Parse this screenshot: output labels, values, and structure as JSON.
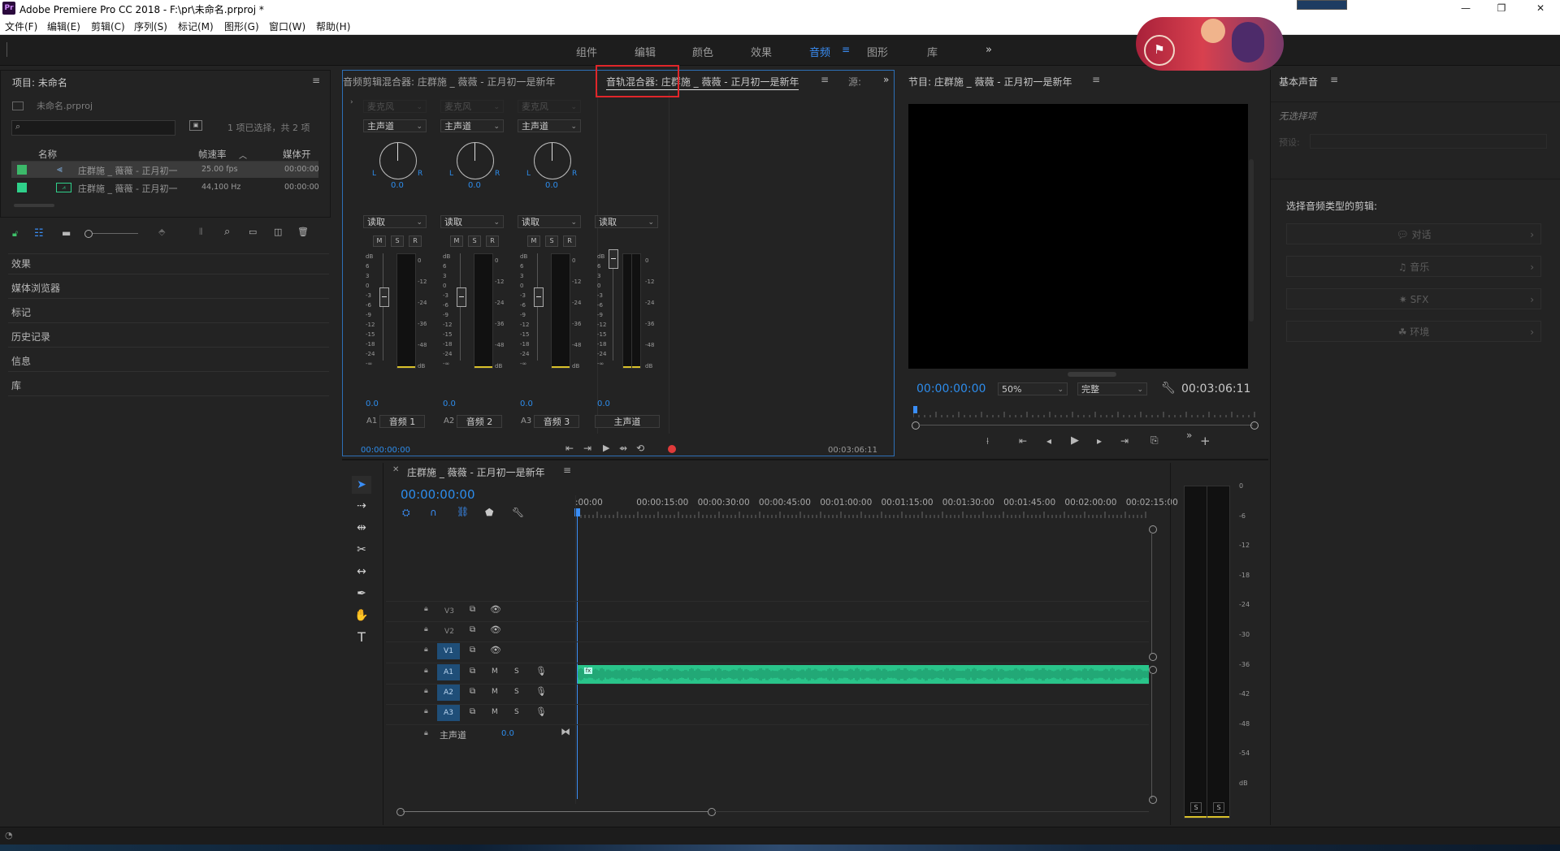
{
  "window": {
    "title": "Adobe Premiere Pro CC 2018 - F:\\pr\\未命名.prproj *",
    "app_badge": "Pr",
    "controls": [
      "—",
      "❐",
      "✕"
    ]
  },
  "menu": [
    "文件(F)",
    "编辑(E)",
    "剪辑(C)",
    "序列(S)",
    "标记(M)",
    "图形(G)",
    "窗口(W)",
    "帮助(H)"
  ],
  "workspaces": {
    "tabs": [
      "组件",
      "编辑",
      "颜色",
      "效果",
      "音频",
      "图形",
      "库"
    ],
    "active": "音频",
    "overflow": "»"
  },
  "project": {
    "title": "项目: 未命名",
    "file": "未命名.prproj",
    "selection_info": "1 项已选择，共 2 项",
    "columns": [
      "名称",
      "帧速率",
      "媒体开始"
    ],
    "items": [
      {
        "name": "庄群施 _ 薇薇 - 正月初一",
        "rate": "25.00 fps",
        "start": "00:00:00",
        "color": "#3cb96a"
      },
      {
        "name": "庄群施 _ 薇薇 - 正月初一",
        "rate": "44,100 Hz",
        "start": "00:00:00",
        "color": "#2fd08a"
      }
    ]
  },
  "left_panels": [
    "效果",
    "媒体浏览器",
    "标记",
    "历史记录",
    "信息",
    "库"
  ],
  "mixer": {
    "tab_clip": "音频剪辑混合器: 庄群施 _ 薇薇 - 正月初一是新年",
    "tab_track": "音轨混合器: 庄群施 _ 薇薇 - 正月初一是新年",
    "tab_source": "源:",
    "input_label": "麦克风",
    "output": "主声道",
    "automation": "读取",
    "pan_value": "0.0",
    "fader_value": "0.0",
    "msr": [
      "M",
      "S",
      "R"
    ],
    "channels": [
      {
        "id": "A1",
        "name": "音频 1"
      },
      {
        "id": "A2",
        "name": "音频 2"
      },
      {
        "id": "A3",
        "name": "音频 3"
      }
    ],
    "master_name": "主声道",
    "db_scale": [
      "dB",
      "6",
      "3",
      "0",
      "-3",
      "-6",
      "-9",
      "-12",
      "-15",
      "-18",
      "-24",
      "-∞"
    ],
    "meter_scale": [
      "0",
      "-12",
      "-24",
      "-36",
      "-48",
      "dB"
    ],
    "timecode_in": "00:00:00:00",
    "timecode_out": "00:03:06:11"
  },
  "program": {
    "title": "节目: 庄群施 _ 薇薇 - 正月初一是新年",
    "timecode": "00:00:00:00",
    "zoom": "50%",
    "quality": "完整",
    "duration": "00:03:06:11"
  },
  "essential_sound": {
    "title": "基本声音",
    "no_selection": "无选择项",
    "preset_label": "预设:",
    "prompt": "选择音频类型的剪辑:",
    "types": [
      "对话",
      "音乐",
      "SFX",
      "环境"
    ]
  },
  "timeline": {
    "title": "庄群施 _ 薇薇 - 正月初一是新年",
    "timecode": "00:00:00:00",
    "ruler": [
      ":00:00",
      "00:00:15:00",
      "00:00:30:00",
      "00:00:45:00",
      "00:01:00:00",
      "00:01:15:00",
      "00:01:30:00",
      "00:01:45:00",
      "00:02:00:00",
      "00:02:15:00"
    ],
    "video_tracks": [
      "V3",
      "V2",
      "V1"
    ],
    "audio_tracks": [
      "A1",
      "A2",
      "A3"
    ],
    "master_label": "主声道",
    "master_value": "0.0",
    "ms": [
      "M",
      "S"
    ]
  },
  "audio_meter": {
    "scale": [
      "0",
      "-6",
      "-12",
      "-18",
      "-24",
      "-30",
      "-36",
      "-42",
      "-48",
      "-54",
      "dB"
    ],
    "solo": [
      "S",
      "S"
    ]
  },
  "colors": {
    "accent": "#2d8ceb",
    "clip": "#29c48a",
    "highlight_box": "#e0262a"
  }
}
